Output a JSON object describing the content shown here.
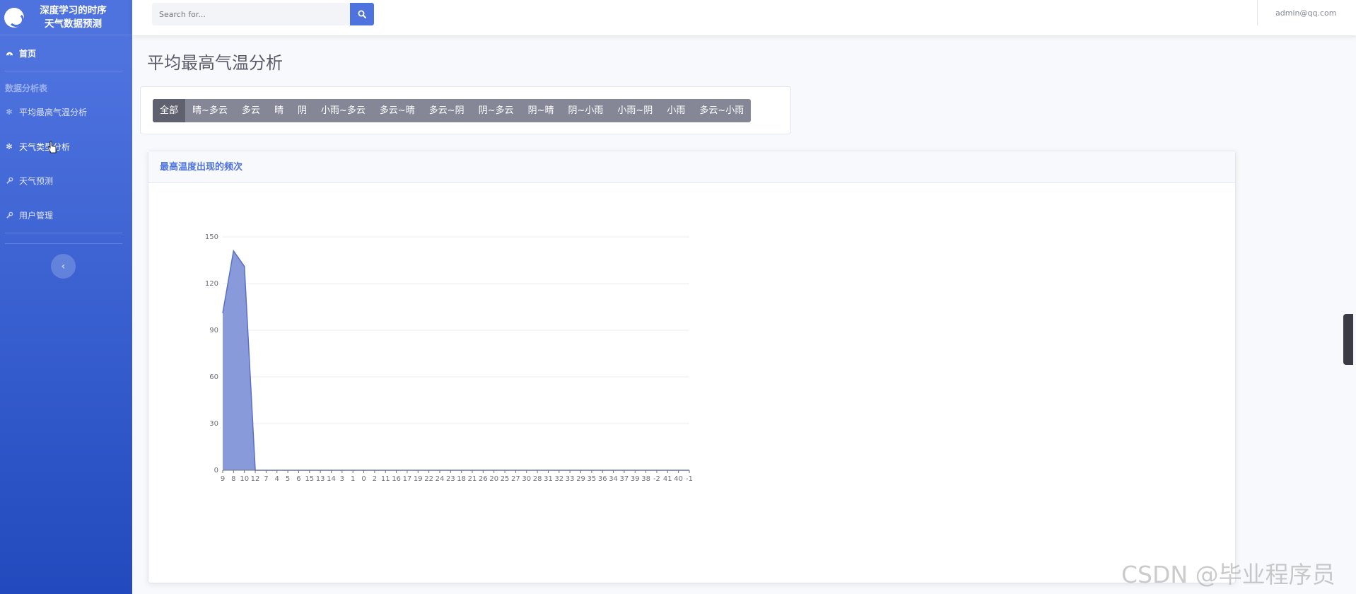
{
  "sidebar": {
    "brand_line1": "深度学习的时序",
    "brand_line2": "天气数据预测",
    "home_label": "首页",
    "section_heading": "数据分析表",
    "items": [
      {
        "label": "平均最高气温分析",
        "icon": "gear-icon"
      },
      {
        "label": "天气类型分析",
        "icon": "gear-icon"
      },
      {
        "label": "天气预测",
        "icon": "wrench-icon"
      },
      {
        "label": "用户管理",
        "icon": "wrench-icon"
      }
    ],
    "toggle_glyph": "‹"
  },
  "topbar": {
    "search_placeholder": "Search for...",
    "user_email": "admin@qq.com"
  },
  "page": {
    "title": "平均最高气温分析"
  },
  "filters": {
    "options": [
      "全部",
      "晴~多云",
      "多云",
      "晴",
      "阴",
      "小雨~多云",
      "多云~晴",
      "多云~阴",
      "阴~多云",
      "阴~晴",
      "阴~小雨",
      "小雨~阴",
      "小雨",
      "多云~小雨"
    ],
    "selected": "全部"
  },
  "chart_card": {
    "header": "最高温度出现的频次"
  },
  "chart_data": {
    "type": "area",
    "title": "",
    "xlabel": "",
    "ylabel": "",
    "x": [
      "9",
      "8",
      "10",
      "12",
      "7",
      "4",
      "5",
      "6",
      "15",
      "13",
      "14",
      "3",
      "1",
      "0",
      "2",
      "11",
      "16",
      "17",
      "19",
      "22",
      "24",
      "23",
      "18",
      "21",
      "26",
      "20",
      "25",
      "27",
      "30",
      "28",
      "31",
      "32",
      "33",
      "29",
      "35",
      "36",
      "34",
      "37",
      "39",
      "38",
      "-2",
      "41",
      "40",
      "-1"
    ],
    "series": [
      {
        "values": [
          101,
          141,
          131,
          0,
          0,
          0,
          0,
          0,
          0,
          0,
          0,
          0,
          0,
          0,
          0,
          0,
          0,
          0,
          0,
          0,
          0,
          0,
          0,
          0,
          0,
          0,
          0,
          0,
          0,
          0,
          0,
          0,
          0,
          0,
          0,
          0,
          0,
          0,
          0,
          0,
          0,
          0,
          0,
          0
        ]
      }
    ],
    "yticks": [
      0,
      30,
      60,
      90,
      120,
      150
    ],
    "ylim": [
      0,
      150
    ],
    "grid": true,
    "color": "#7b8fd6"
  },
  "watermark": "CSDN @毕业程序员"
}
